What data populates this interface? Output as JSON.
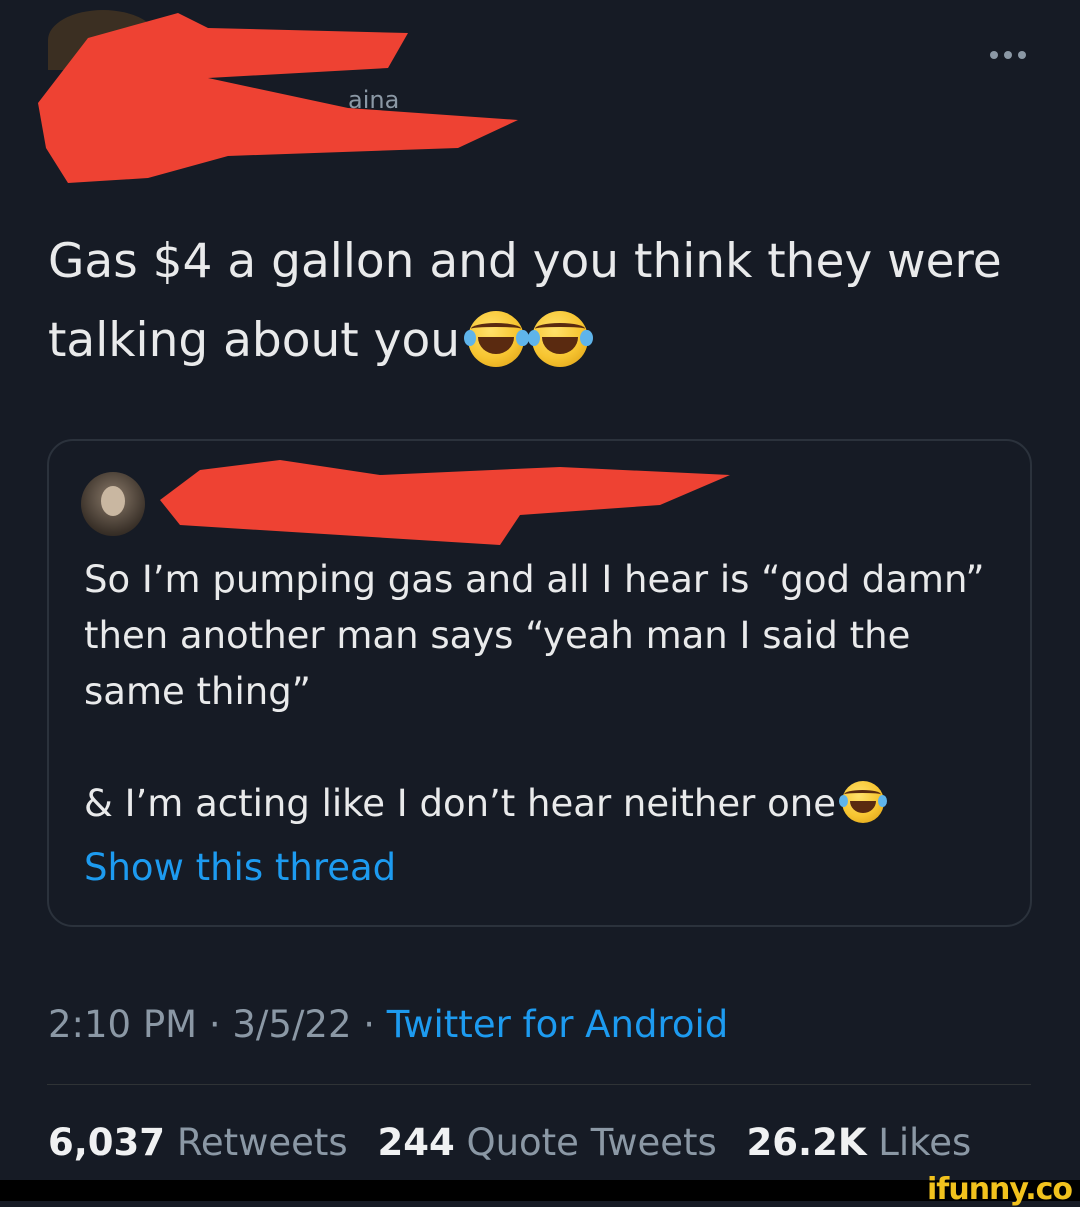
{
  "tweet": {
    "text": "Gas $4 a gallon and you think they were talking about you",
    "emoji": [
      "face-with-tears-of-joy",
      "face-with-tears-of-joy"
    ]
  },
  "quoted_tweet": {
    "paragraph1": "So I’m pumping gas and all I hear is “god damn” then another man says “yeah man I said the same thing”",
    "paragraph2": "& I’m acting like I don’t hear neither one",
    "emoji": "face-with-tears-of-joy",
    "show_thread": "Show this thread"
  },
  "meta": {
    "time": "2:10 PM",
    "separator": "·",
    "date": "3/5/22",
    "source": "Twitter for Android"
  },
  "stats": {
    "retweets_count": "6,037",
    "retweets_label": "Retweets",
    "quotes_count": "244",
    "quotes_label": "Quote Tweets",
    "likes_count": "26.2K",
    "likes_label": "Likes"
  },
  "watermark": "ifunny.co",
  "colors": {
    "background": "#161b25",
    "text": "#e9eaeb",
    "muted": "#8b98a5",
    "link": "#1d9bf0",
    "redaction": "#ee4233",
    "watermark": "#f2c21d"
  }
}
